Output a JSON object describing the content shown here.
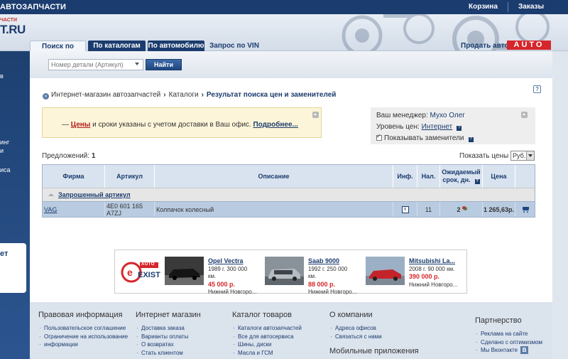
{
  "topbar": {
    "title": "АВТОЗАПЧАСТИ",
    "cart": "Корзина",
    "orders": "Заказы"
  },
  "logo": {
    "small": "ЧАСТИ",
    "big": "T.RU"
  },
  "tabs": [
    {
      "label": "Поиск по номеру"
    },
    {
      "label": "По каталогам"
    },
    {
      "label": "По автомобилю"
    },
    {
      "label": "Запрос по VIN »"
    }
  ],
  "header": {
    "sell_car": "Продать авто",
    "auto_badge": "AUTO"
  },
  "search": {
    "placeholder": "Номер детали (Артикул)",
    "button": "Найти"
  },
  "sidebar_fragments": [
    "в",
    "инг",
    "и",
    "иса",
    "ет"
  ],
  "breadcrumb": {
    "item1": "Интернет-магазин автозапчастей",
    "item2": "Каталоги",
    "current": "Результат поиска цен и заменителей"
  },
  "notice": {
    "dash": "— ",
    "prices": "Цены",
    "middle": " и сроки указаны с учетом доставки в Ваш офис. ",
    "more": "Подробнее..."
  },
  "manager": {
    "label": "Ваш менеджер: ",
    "name": "Мухо Олег",
    "price_level_label": "Уровень цен: ",
    "price_level": "Интернет",
    "show_replacements": "Показывать заменители"
  },
  "results": {
    "offers_label": "Предложений: ",
    "offers_count": "1",
    "show_prices_in": "Показать цены в",
    "currency": "Руб.",
    "headers": {
      "firm": "Фирма",
      "article": "Артикул",
      "description": "Описание",
      "info": "Инф.",
      "availability": "Нал.",
      "expected_l1": "Ожидаемый",
      "expected_l2": "срок, дн.",
      "price": "Цена"
    },
    "group": "Запрошенный артикул",
    "row": {
      "firm": "VAG",
      "article": "4E0 601 165 A7ZJ",
      "description": "Колпачок колесный",
      "info_icon": "i",
      "availability": "11",
      "expected": "2",
      "price": "1 265,63р."
    }
  },
  "ad": {
    "logo_top": "AUTO",
    "logo_main": "EXIST",
    "cars": [
      {
        "title": "Opel Vectra",
        "info1": "1989 г. 300 000",
        "info2": "км.",
        "price": "45 000 р.",
        "city": "Нижний Новгоро..."
      },
      {
        "title": "Saab 9000",
        "info1": "1992 г. 250 000",
        "info2": "км.",
        "price": "88 000 р.",
        "city": "Нижний Новгоро..."
      },
      {
        "title": "Mitsubishi La...",
        "info1": "2008 г. 90 000 км.",
        "info2": "",
        "price": "390 000 р.",
        "city": "Нижний Новгоро..."
      }
    ]
  },
  "footer": {
    "legal": {
      "title": "Правовая информация",
      "items": [
        "Пользовательское соглашение",
        "Ограничение на использование",
        "информации"
      ]
    },
    "shop": {
      "title": "Интернет магазин",
      "items": [
        "Доставка заказа",
        "Варианты оплаты",
        "О возвратах",
        "Стать клиентом"
      ]
    },
    "catalog": {
      "title": "Каталог товаров",
      "items": [
        "Каталоги автозапчастей",
        "Все для автосервиса",
        "Шины, диски",
        "Масла и ГСМ"
      ]
    },
    "company": {
      "title": "О компании",
      "items": [
        "Адреса офисов",
        "Связаться с нами"
      ]
    },
    "mobile": "Мобильные приложения",
    "partners": {
      "title": "Партнерство",
      "items": [
        "Реклама на сайте",
        "Сделано с оптимизмом",
        "Мы Вконтакте"
      ],
      "vk": "В"
    }
  }
}
